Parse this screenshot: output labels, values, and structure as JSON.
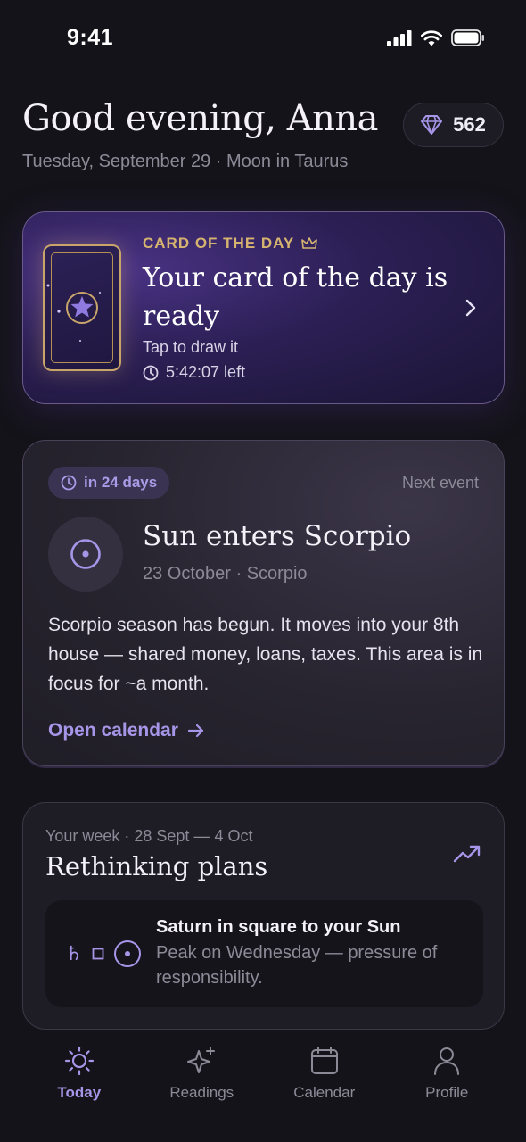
{
  "status_bar": {
    "time": "9:41"
  },
  "header": {
    "greeting": "Good evening, Anna",
    "subline": "Tuesday, September 29 · Moon in Taurus",
    "gems": "562"
  },
  "card_of_day": {
    "label": "CARD OF THE DAY",
    "title": "Your card of the day is ready",
    "subtitle": "Tap to draw it",
    "timer": "5:42:07 left"
  },
  "next_event": {
    "pill": "in 24 days",
    "label": "Next event",
    "title": "Sun enters Scorpio",
    "date": "23 October · Scorpio",
    "description": "Scorpio season has begun. It moves into your 8th house — shared money, loans, taxes. This area is in focus for ~a month.",
    "link": "Open calendar"
  },
  "week": {
    "range": "Your week · 28 Sept — 4 Oct",
    "title": "Rethinking plans",
    "aspect": {
      "title": "Saturn in square to your Sun",
      "description": "Peak on Wednesday — pressure of responsibility.",
      "glyph_saturn": "♄"
    }
  },
  "tabs": [
    {
      "label": "Today",
      "icon": "sun-icon",
      "active": true
    },
    {
      "label": "Readings",
      "icon": "sparkle-icon",
      "active": false
    },
    {
      "label": "Calendar",
      "icon": "calendar-icon",
      "active": false
    },
    {
      "label": "Profile",
      "icon": "person-icon",
      "active": false
    }
  ],
  "colors": {
    "accent": "#a795e8",
    "gold": "#d6b470",
    "background": "#141319"
  }
}
